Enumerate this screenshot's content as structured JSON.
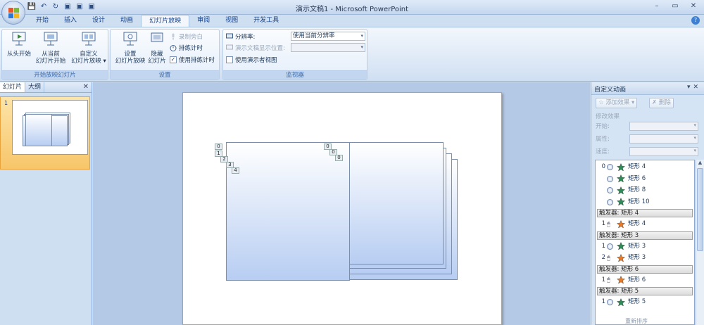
{
  "window": {
    "title": "演示文稿1 - Microsoft PowerPoint",
    "controls": [
      "–",
      "▭",
      "✕"
    ]
  },
  "qat": [
    "💾",
    "↶",
    "↻",
    "▣",
    "▣",
    "▣"
  ],
  "tabs": [
    "开始",
    "插入",
    "设计",
    "动画",
    "幻灯片放映",
    "审阅",
    "视图",
    "开发工具"
  ],
  "active_tab": "幻灯片放映",
  "ribbon": {
    "group_start": {
      "label": "开始放映幻灯片",
      "from_beginning": "从头开始",
      "from_current_1": "从当前",
      "from_current_2": "幻灯片开始",
      "custom_1": "自定义",
      "custom_2": "幻灯片放映 ▾"
    },
    "group_setup": {
      "label": "设置",
      "setup_1": "设置",
      "setup_2": "幻灯片放映",
      "hide_1": "隐藏",
      "hide_2": "幻灯片",
      "record_narration": "录制旁白",
      "rehearse_timings": "排练计时",
      "use_rehearsed": "使用排练计时",
      "use_rehearsed_checked": true
    },
    "group_monitors": {
      "label": "监视器",
      "resolution_label": "分辨率:",
      "resolution_value": "使用当前分辨率",
      "show_on_label": "演示文稿显示位置:",
      "show_on_value": "",
      "presenter_view": "使用演示者视图"
    }
  },
  "left_pane": {
    "tabs": [
      "幻灯片",
      "大纲"
    ],
    "close": "✕",
    "slide_number": "1"
  },
  "slide_tags": [
    "0",
    "1",
    "2",
    "3",
    "4",
    "0",
    "0",
    "0"
  ],
  "task_pane": {
    "title": "自定义动画",
    "add_effect": "添加效果 ▾",
    "remove": "删除",
    "modify_title": "修改效果",
    "start_label": "开始:",
    "property_label": "属性:",
    "speed_label": "速度:",
    "items": [
      {
        "kind": "row",
        "num": "0",
        "icon": "clock",
        "star": "green",
        "label": "矩形 4"
      },
      {
        "kind": "row",
        "num": "",
        "icon": "clock",
        "star": "green",
        "label": "矩形 6"
      },
      {
        "kind": "row",
        "num": "",
        "icon": "clock",
        "star": "green",
        "label": "矩形 8"
      },
      {
        "kind": "row",
        "num": "",
        "icon": "clock",
        "star": "green",
        "label": "矩形 10"
      },
      {
        "kind": "trigger",
        "label": "触发器: 矩形 4"
      },
      {
        "kind": "row",
        "num": "1",
        "icon": "mouse",
        "star": "orange",
        "label": "矩形 4"
      },
      {
        "kind": "trigger",
        "label": "触发器: 矩形 3"
      },
      {
        "kind": "row",
        "num": "1",
        "icon": "clock",
        "star": "green",
        "label": "矩形 3"
      },
      {
        "kind": "row",
        "num": "2",
        "icon": "mouse",
        "star": "orange",
        "label": "矩形 3"
      },
      {
        "kind": "trigger",
        "label": "触发器: 矩形 6"
      },
      {
        "kind": "row",
        "num": "1",
        "icon": "mouse",
        "star": "orange",
        "label": "矩形 6"
      },
      {
        "kind": "trigger",
        "label": "触发器: 矩形 5"
      },
      {
        "kind": "row",
        "num": "1",
        "icon": "clock",
        "star": "green",
        "label": "矩形 5"
      }
    ],
    "reorder": "重新排序"
  },
  "colors": {
    "accent": "#15428b",
    "ribbon_bg": "#dbe7f6",
    "star_green": "#2e8b57",
    "star_orange": "#e87b2a"
  }
}
